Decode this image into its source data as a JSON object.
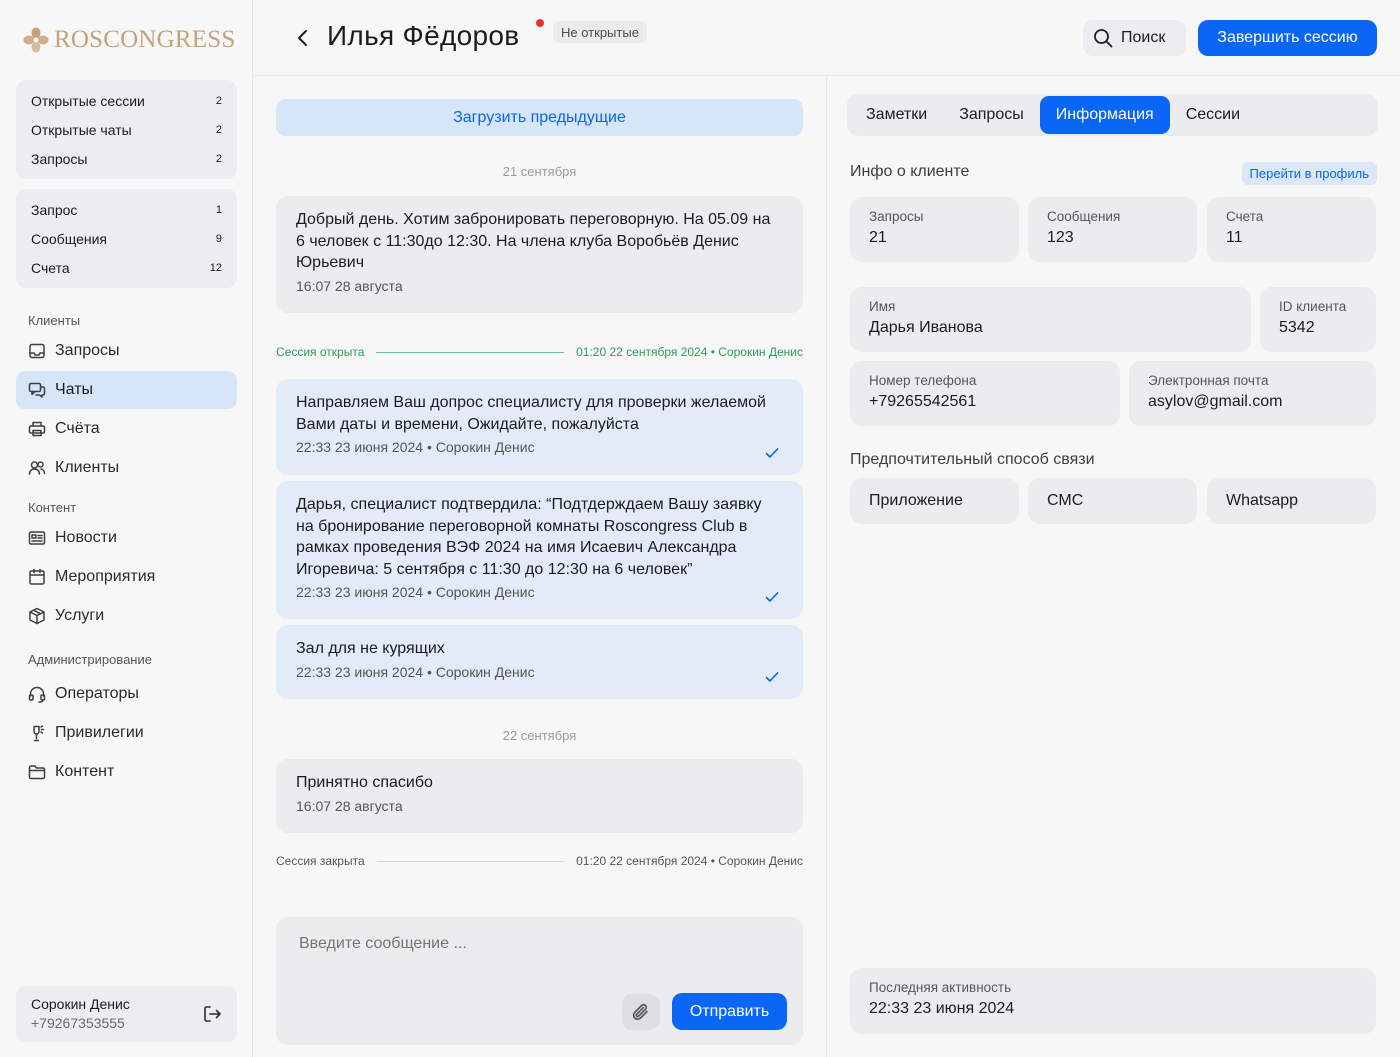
{
  "brand": {
    "name": "ROSCONGRESS"
  },
  "sidebar": {
    "counters_top": [
      {
        "label": "Открытые сессии",
        "count": "2"
      },
      {
        "label": "Открытые чаты",
        "count": "2"
      },
      {
        "label": "Запросы",
        "count": "2"
      }
    ],
    "counters_bottom": [
      {
        "label": "Запрос",
        "count": "1"
      },
      {
        "label": "Сообщения",
        "count": "9"
      },
      {
        "label": "Счета",
        "count": "12"
      }
    ],
    "sections": {
      "clients": "Клиенты",
      "content": "Контент",
      "admin": "Администрирование"
    },
    "nav": [
      {
        "label": "Запросы",
        "icon": "inbox-icon"
      },
      {
        "label": "Чаты",
        "icon": "chat-icon",
        "active": true
      },
      {
        "label": "Счёта",
        "icon": "printer-icon"
      },
      {
        "label": "Клиенты",
        "icon": "users-icon"
      },
      {
        "label": "Новости",
        "icon": "news-icon"
      },
      {
        "label": "Мероприятия",
        "icon": "calendar-icon"
      },
      {
        "label": "Услуги",
        "icon": "box-icon"
      },
      {
        "label": "Операторы",
        "icon": "headset-icon"
      },
      {
        "label": "Привилегии",
        "icon": "privilege-icon"
      },
      {
        "label": "Контент",
        "icon": "folder-icon"
      }
    ],
    "user": {
      "name": "Сорокин Денис",
      "phone": "+79267353555"
    }
  },
  "header": {
    "title": "Илья Фёдоров",
    "status": "Не открытые",
    "search_label": "Поиск",
    "end_session_label": "Завершить сессию"
  },
  "chat": {
    "load_previous": "Загрузить предыдущие",
    "date_1": "21 сентября",
    "date_2": "22 сентября",
    "messages": [
      {
        "text": "Добрый день. Хотим забронировать переговорную. На 05.09 на 6 человек с 11:30до 12:30. На члена клуба Воробьёв Денис Юрьевич",
        "meta": "16:07 28 августа"
      },
      {
        "text": "Направляем Ваш допрос специалисту для проверки желаемой Вами даты и времени, Ожидайте, пожалуйста",
        "meta": "22:33 23 июня 2024 • Сорокин Денис"
      },
      {
        "text": "Дарья, специалист подтвердила: “Подтдерждаем Вашу заявку на бронирование переговорной комнаты Roscongress Club в рамках проведения ВЭФ 2024 на имя Исаевич Александра Игоревича: 5 сентября с 11:30 до 12:30 на 6 человек”",
        "meta": "22:33 23 июня 2024 • Сорокин Денис"
      },
      {
        "text": "Зал для не курящих",
        "meta": "22:33 23 июня 2024 • Сорокин Денис"
      },
      {
        "text": "Принятно спасибо",
        "meta": "16:07 28 августа"
      }
    ],
    "session_opened": {
      "label": "Сессия открыта",
      "meta": "01:20 22 сентября 2024 • Сорокин Денис"
    },
    "session_closed": {
      "label": "Сессия закрыта",
      "meta": "01:20 22 сентября 2024 • Сорокин Денис"
    },
    "composer_placeholder": "Введите сообщение ...",
    "send_label": "Отправить"
  },
  "info": {
    "tabs": [
      "Заметки",
      "Запросы",
      "Информация",
      "Сессии"
    ],
    "active_tab": "Информация",
    "heading": "Инфо о клиенте",
    "profile_link": "Перейти в профиль",
    "stats": [
      {
        "label": "Запросы",
        "value": "21"
      },
      {
        "label": "Сообщения",
        "value": "123"
      },
      {
        "label": "Счета",
        "value": "11"
      }
    ],
    "name": {
      "label": "Имя",
      "value": "Дарья Иванова"
    },
    "client_id": {
      "label": "ID клиента",
      "value": "5342"
    },
    "phone": {
      "label": "Номер телефона",
      "value": "+79265542561"
    },
    "email": {
      "label": "Электронная почта",
      "value": "asylov@gmail.com"
    },
    "pref_title": "Предпочтительный способ связи",
    "pref_options": [
      "Приложение",
      "СМС",
      "Whatsapp"
    ],
    "last_activity": {
      "label": "Последняя активность",
      "value": "22:33 23 июня 2024"
    }
  },
  "colors": {
    "accent": "#0a66f5",
    "brand": "#c6a278",
    "session_open": "#2f9a5a",
    "unread_dot": "#e5332a"
  }
}
